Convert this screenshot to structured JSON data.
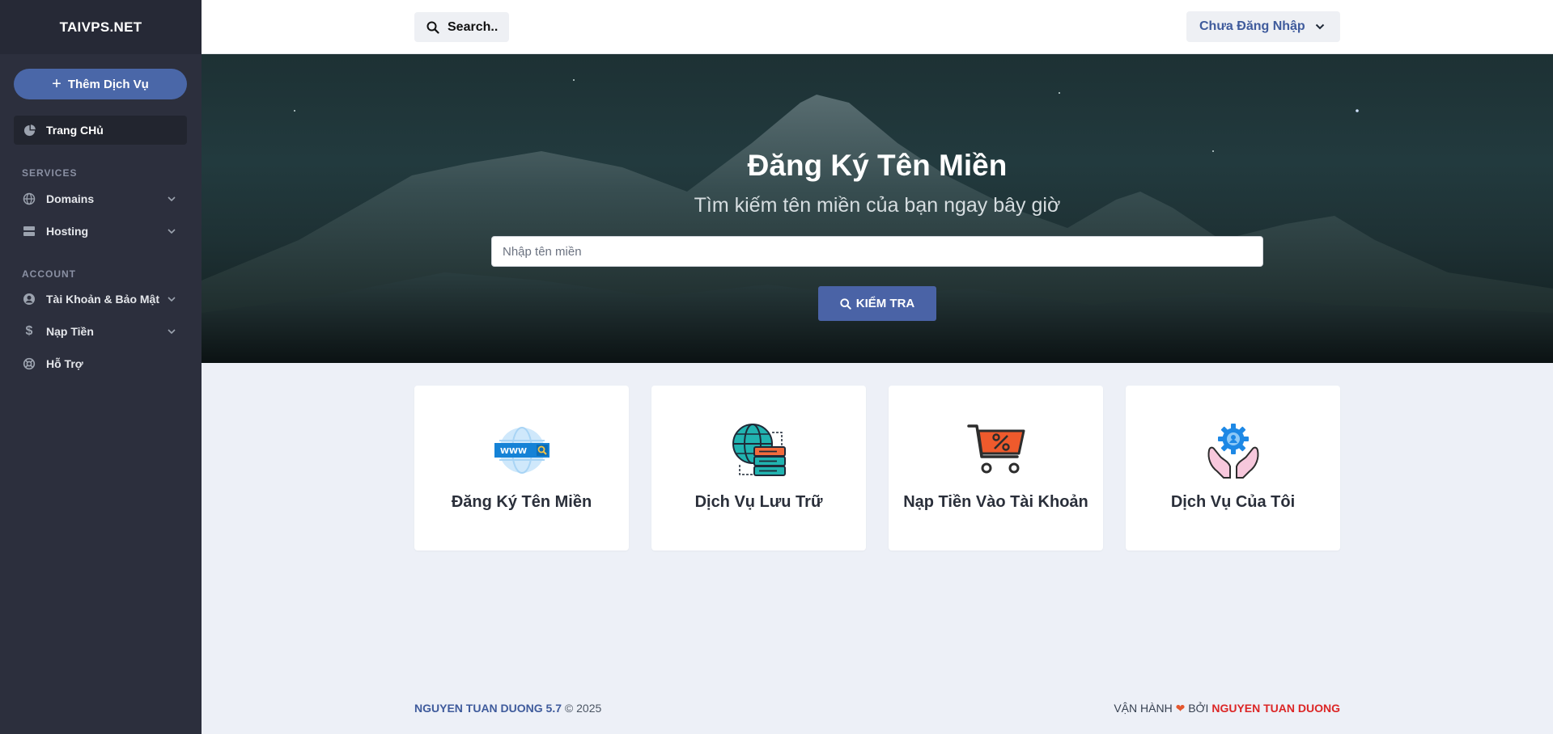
{
  "brand": "TAIVPS.NET",
  "add_service": "Thêm Dịch Vụ",
  "home": "Trang CHủ",
  "sections": {
    "services": "SERVICES",
    "account": "ACCOUNT"
  },
  "nav": {
    "domains": "Domains",
    "hosting": "Hosting",
    "account_security": "Tài Khoản & Bảo Mật",
    "topup": "Nạp Tiền",
    "support": "Hỗ Trợ"
  },
  "topbar": {
    "search": "Search..",
    "login": "Chưa Đăng Nhập"
  },
  "hero": {
    "title": "Đăng Ký Tên Miền",
    "subtitle": "Tìm kiếm tên miền của bạn ngay bây giờ",
    "placeholder": "Nhập tên miền",
    "button": "KIỂM TRA"
  },
  "cards": [
    {
      "label": "Đăng Ký Tên Miền",
      "icon": "www-globe-icon"
    },
    {
      "label": "Dịch Vụ Lưu Trữ",
      "icon": "globe-server-icon"
    },
    {
      "label": "Nạp Tiền Vào Tài Khoản",
      "icon": "cart-percent-icon"
    },
    {
      "label": "Dịch Vụ Của Tôi",
      "icon": "hands-gear-icon"
    }
  ],
  "footer": {
    "left_brand": "NGUYEN TUAN DUONG 5.7",
    "left_copy": "© 2025",
    "right_prefix": "VẬN HÀNH",
    "right_by": "BỞI",
    "right_name": "NGUYEN TUAN DUONG"
  },
  "colors": {
    "sidebar": "#2c2f3d",
    "accent": "#4a67a8",
    "footer_red": "#dc2626"
  }
}
